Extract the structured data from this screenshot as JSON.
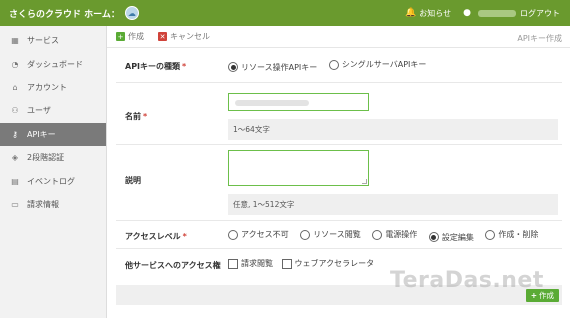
{
  "header": {
    "title": "さくらのクラウド ホーム：",
    "logo_icon": "cloud-logo-icon",
    "news_label": "お知らせ",
    "logout_label": "ログアウト",
    "accent_color": "#6a9a2e"
  },
  "sidebar": {
    "items": [
      {
        "label": "サービス",
        "icon": "grid-icon"
      },
      {
        "label": "ダッシュボード",
        "icon": "dashboard-icon"
      },
      {
        "label": "アカウント",
        "icon": "account-icon"
      },
      {
        "label": "ユーザ",
        "icon": "users-icon"
      },
      {
        "label": "APIキー",
        "icon": "key-icon",
        "active": true
      },
      {
        "label": "2段階認証",
        "icon": "shield-icon"
      },
      {
        "label": "イベントログ",
        "icon": "log-icon"
      },
      {
        "label": "請求情報",
        "icon": "billing-icon"
      }
    ]
  },
  "toolbar": {
    "create_label": "作成",
    "cancel_label": "キャンセル",
    "page_title": "APIキー作成"
  },
  "form": {
    "key_type": {
      "label": "APIキーの種類",
      "required_mark": "*",
      "options": [
        "リソース操作APIキー",
        "シングルサーバAPIキー"
      ],
      "selected": "リソース操作APIキー"
    },
    "name": {
      "label": "名前",
      "required_mark": "*",
      "value": "",
      "hint": "1〜64文字"
    },
    "description": {
      "label": "説明",
      "value": "",
      "hint": "任意, 1〜512文字"
    },
    "access_level": {
      "label": "アクセスレベル",
      "required_mark": "*",
      "options": [
        "アクセス不可",
        "リソース閲覧",
        "電源操作",
        "設定編集",
        "作成・削除"
      ],
      "selected": "設定編集"
    },
    "other_services": {
      "label": "他サービスへのアクセス権",
      "options": [
        "請求閲覧",
        "ウェブアクセラレータ"
      ]
    }
  },
  "footer": {
    "create_label": "作成"
  },
  "watermark": "TeraDas.net"
}
